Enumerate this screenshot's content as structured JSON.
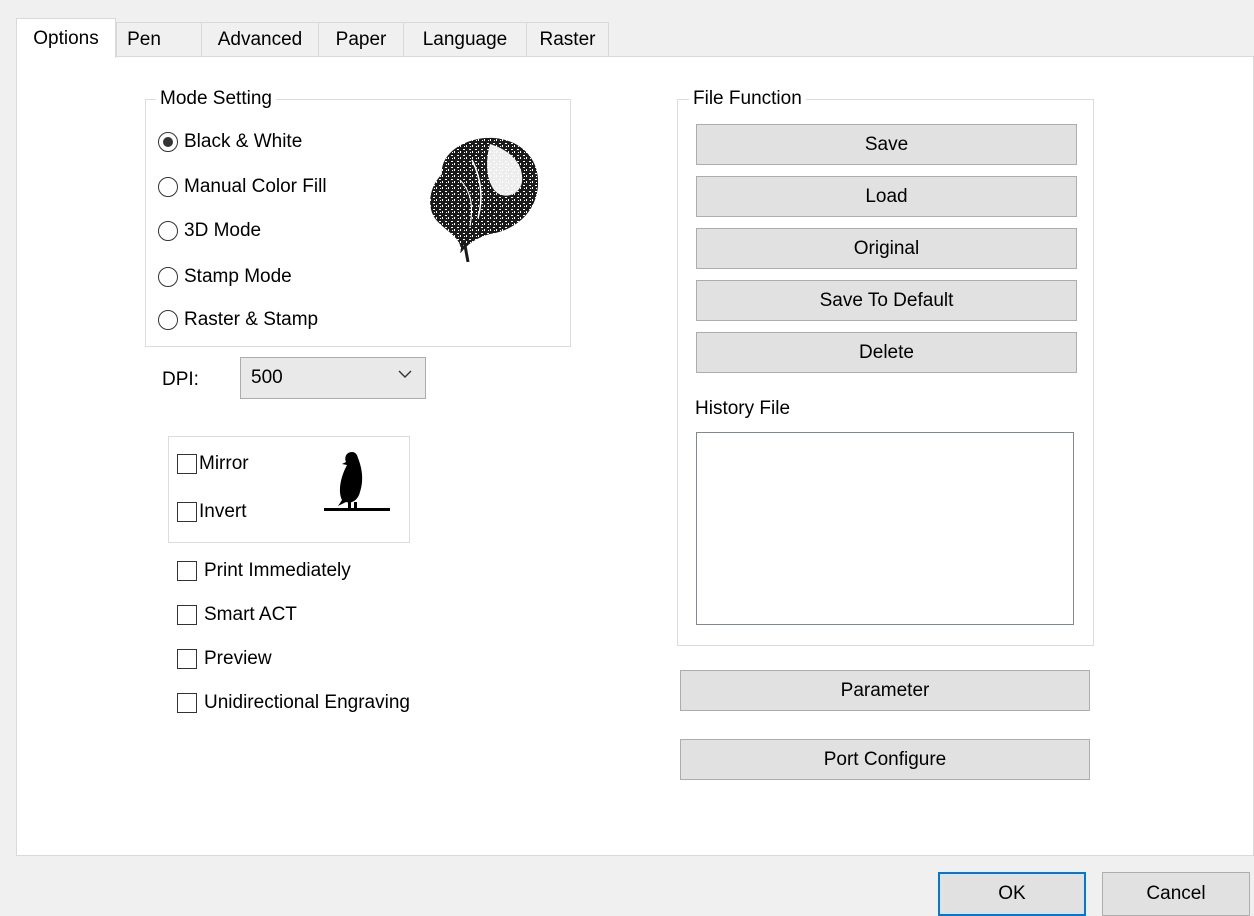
{
  "tabs": [
    {
      "label": "Options",
      "active": true
    },
    {
      "label": "Pen"
    },
    {
      "label": "Advanced"
    },
    {
      "label": "Paper"
    },
    {
      "label": "Language"
    },
    {
      "label": "Raster"
    }
  ],
  "mode_setting": {
    "title": "Mode Setting",
    "options": [
      {
        "label": "Black & White",
        "checked": true
      },
      {
        "label": "Manual Color Fill",
        "checked": false
      },
      {
        "label": "3D Mode",
        "checked": false
      },
      {
        "label": "Stamp Mode",
        "checked": false
      },
      {
        "label": "Raster & Stamp",
        "checked": false
      }
    ],
    "preview_icon": "tree-engraving-icon"
  },
  "dpi": {
    "label": "DPI:",
    "value": "500"
  },
  "transform": {
    "mirror_label": "Mirror",
    "invert_label": "Invert",
    "preview_icon": "bird-silhouette-icon"
  },
  "options": {
    "print_immediately": "Print Immediately",
    "smart_act": "Smart ACT",
    "preview": "Preview",
    "unidirectional": "Unidirectional Engraving"
  },
  "file_function": {
    "title": "File Function",
    "buttons": [
      "Save",
      "Load",
      "Original",
      "Save To Default",
      "Delete"
    ],
    "history_label": "History File"
  },
  "parameter_label": "Parameter",
  "port_configure_label": "Port Configure",
  "dialog": {
    "ok_label": "OK",
    "cancel_label": "Cancel"
  },
  "colors": {
    "accent": "#0078d7",
    "panel": "#ffffff",
    "window": "#f0f0f0"
  }
}
